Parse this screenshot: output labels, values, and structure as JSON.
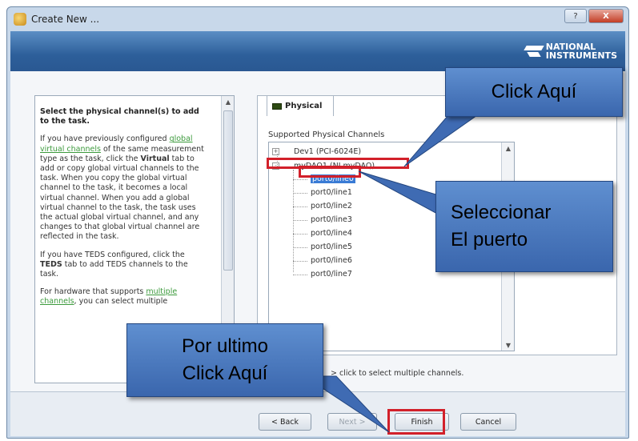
{
  "window": {
    "title": "Create New ...",
    "help_label": "?",
    "close_label": "X"
  },
  "banner": {
    "logo_line1": "NATIONAL",
    "logo_line2": "INSTRUMENTS"
  },
  "help": {
    "heading": "Select the physical channel(s) to add to the task.",
    "p1_a": "If you have previously configured ",
    "p1_link": "global virtual channels",
    "p1_b": " of the same measurement type as the task, click the ",
    "p1_bold": "Virtual",
    "p1_c": " tab to add or copy global virtual channels to the task. When you copy the global virtual channel to the task, it becomes a local virtual channel. When you add a global virtual channel to the task, the task uses the actual global virtual channel, and any changes to that global virtual channel are reflected in the task.",
    "p2_a": "If you have TEDS configured, click the ",
    "p2_bold": "TEDS",
    "p2_b": " tab to add TEDS channels to the task.",
    "p3_a": "For hardware that supports ",
    "p3_link": "multiple channels",
    "p3_b": ", you can select multiple"
  },
  "tab": {
    "physical_label": "Physical"
  },
  "channels": {
    "supported_label": "Supported Physical Channels",
    "devices": [
      {
        "label": "Dev1 (PCI-6024E)",
        "expander": "+"
      },
      {
        "label": "myDAQ1 (NI myDAQ)",
        "expander": "-"
      }
    ],
    "lines": [
      "port0/line0",
      "port0/line1",
      "port0/line2",
      "port0/line3",
      "port0/line4",
      "port0/line5",
      "port0/line6",
      "port0/line7"
    ],
    "selected_index": 0
  },
  "hint": "<Shift>-click or <Ctrl>-click to select multiple channels.",
  "hint_visible": "> click to select multiple channels.",
  "buttons": {
    "back": "< Back",
    "next": "Next >",
    "finish": "Finish",
    "cancel": "Cancel"
  },
  "callouts": {
    "click_here": "Click Aquí",
    "select_port_line1": "Seleccionar",
    "select_port_line2": "El puerto",
    "finally_line1": "Por ultimo",
    "finally_line2": "Click Aquí"
  },
  "colors": {
    "highlight_red": "#d2202a",
    "callout_blue": "#4a78bd",
    "selection_blue": "#3a7bd5",
    "link_green": "#3c9a3c"
  }
}
